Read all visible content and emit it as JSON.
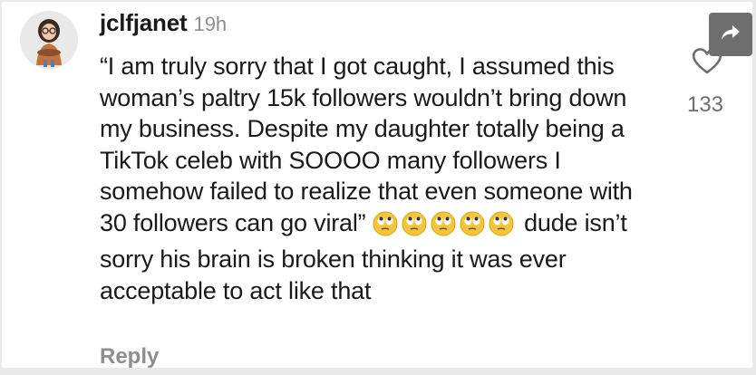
{
  "comment": {
    "username": "jclfjanet",
    "timestamp": "19h",
    "text_before_emoji": "“I am truly sorry that I got caught, I assumed this woman’s paltry 15k followers wouldn’t bring down my business. Despite my daughter totally being a TikTok celeb with SOOOO many followers I somehow failed to realize that even someone with 30 followers can go viral” ",
    "emojis": [
      "rolling-eyes-emoji",
      "rolling-eyes-emoji",
      "rolling-eyes-emoji",
      "rolling-eyes-emoji",
      "rolling-eyes-emoji"
    ],
    "text_after_emoji": "dude isn’t sorry his brain is broken thinking it was ever acceptable to act like that",
    "reply_label": "Reply",
    "like_count": "133"
  },
  "icons": {
    "avatar": "user-avatar",
    "share": "share-arrow-icon",
    "like": "heart-outline-icon"
  },
  "colors": {
    "text": "#1a1a1a",
    "muted": "#8e8e8e",
    "share_bg": "#6e6e6e"
  }
}
